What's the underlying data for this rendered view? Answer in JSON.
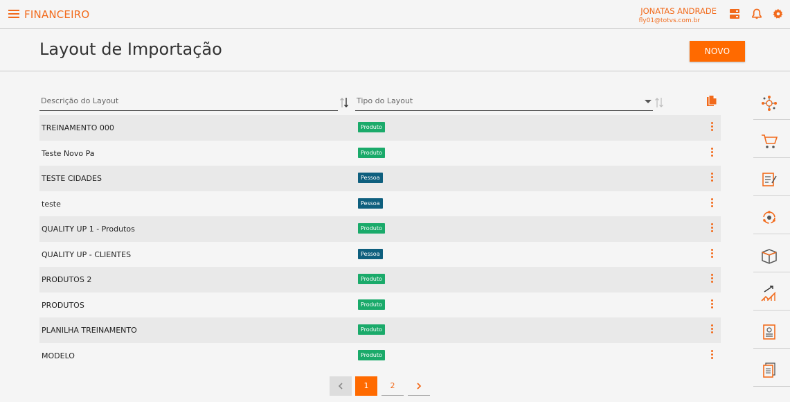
{
  "app": {
    "title": "FINANCEIRO"
  },
  "user": {
    "name": "JONATAS ANDRADE",
    "email": "fly01@totvs.com.br"
  },
  "header": {
    "title": "Layout de Importação",
    "new_button": "NOVO"
  },
  "filters": {
    "description_placeholder": "Descrição do Layout",
    "type_placeholder": "Tipo do Layout"
  },
  "rows": [
    {
      "description": "TREINAMENTO 000",
      "type": "Produto"
    },
    {
      "description": "Teste Novo Pa",
      "type": "Produto"
    },
    {
      "description": "TESTE CIDADES",
      "type": "Pessoa"
    },
    {
      "description": "teste",
      "type": "Pessoa"
    },
    {
      "description": "QUALITY UP 1 - Produtos",
      "type": "Produto"
    },
    {
      "description": "QUALITY UP - CLIENTES",
      "type": "Pessoa"
    },
    {
      "description": "PRODUTOS 2",
      "type": "Produto"
    },
    {
      "description": "PRODUTOS",
      "type": "Produto"
    },
    {
      "description": "PLANILHA TREINAMENTO",
      "type": "Produto"
    },
    {
      "description": "MODELO",
      "type": "Produto"
    }
  ],
  "pagination": {
    "pages": [
      "1",
      "2"
    ],
    "current": "1",
    "prev_icon": "chevron-left-icon",
    "next_icon": "chevron-right-icon"
  },
  "icons": {
    "menu": "hamburger-icon",
    "server": "server-icon",
    "bell": "bell-icon",
    "settings": "gear-icon",
    "copy": "copy-icon",
    "row_menu": "kebab-icon"
  },
  "sidebar_icons": [
    "network-icon",
    "cart-icon",
    "invoice-icon",
    "cycle-icon",
    "box-icon",
    "growth-chart-icon",
    "report-icon",
    "documents-icon"
  ],
  "colors": {
    "accent": "#ff6a00",
    "produto": "#1aaa6a",
    "pessoa": "#0e5f7e"
  }
}
